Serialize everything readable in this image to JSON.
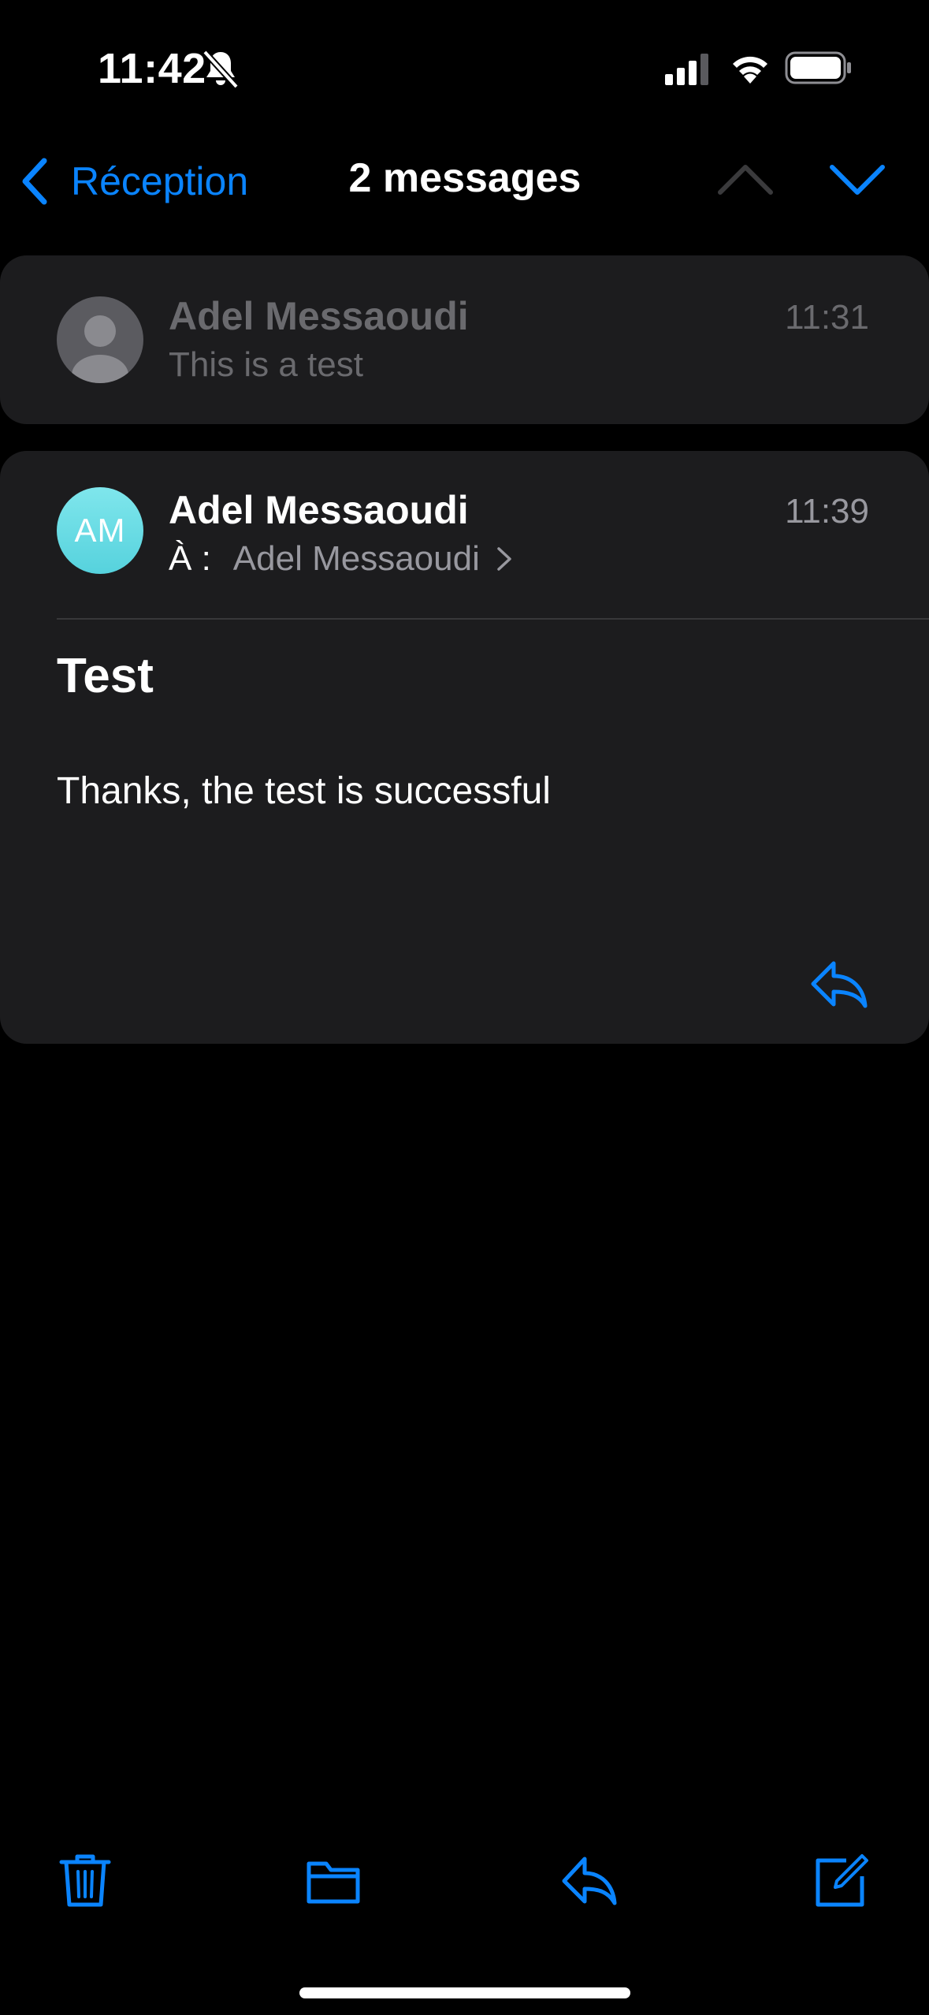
{
  "status_bar": {
    "time": "11:42",
    "icons": [
      "bell-slash-icon",
      "cellular-signal-icon",
      "wifi-icon",
      "battery-icon"
    ]
  },
  "nav": {
    "back_label": "Réception",
    "title": "2 messages",
    "up_icon": "chevron-up-icon",
    "down_icon": "chevron-down-icon"
  },
  "messages": [
    {
      "sender": "Adel Messaoudi",
      "time": "11:31",
      "preview": "This is a test",
      "avatar_icon": "person-placeholder-icon",
      "state": "collapsed"
    },
    {
      "sender": "Adel Messaoudi",
      "time": "11:39",
      "avatar_initials": "AM",
      "to_label": "À :",
      "to_name": "Adel Messaoudi",
      "subject": "Test",
      "body": "Thanks, the test is successful",
      "state": "expanded"
    }
  ],
  "toolbar": {
    "icons": [
      "trash-icon",
      "folder-icon",
      "reply-icon",
      "compose-icon"
    ]
  },
  "colors": {
    "accent": "#0a84ff",
    "background": "#000000",
    "card": "#1c1c1e",
    "secondary_text": "#98989f",
    "avatar_gradient": "#56d2dd"
  }
}
